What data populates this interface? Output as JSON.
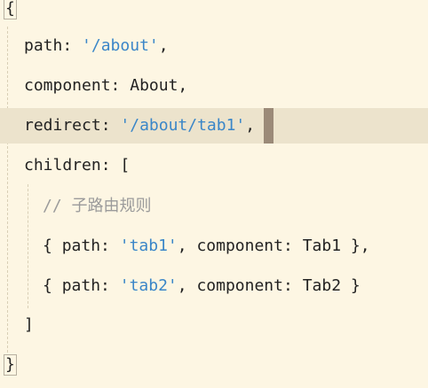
{
  "editor": {
    "lines": [
      {
        "text": "{"
      },
      {
        "key": "path",
        "sep": ": ",
        "str": "'/about'",
        "tail": ","
      },
      {
        "key": "component",
        "sep": ": ",
        "value": "About",
        "tail": ","
      },
      {
        "key": "redirect",
        "sep": ": ",
        "str": "'/about/tab1'",
        "tail": ","
      },
      {
        "key": "children",
        "sep": ": ",
        "tail": "["
      },
      {
        "comment": "// 子路由规则"
      },
      {
        "open": "{ ",
        "key1": "path",
        "sep1": ": ",
        "str": "'tab1'",
        "mid": ", ",
        "key2": "component",
        "sep2": ": ",
        "value": "Tab1",
        "close": " },"
      },
      {
        "open": "{ ",
        "key1": "path",
        "sep1": ": ",
        "str": "'tab2'",
        "mid": ", ",
        "key2": "component",
        "sep2": ": ",
        "value": "Tab2",
        "close": " }"
      },
      {
        "text": "]"
      },
      {
        "text": "}"
      }
    ]
  },
  "colors": {
    "background": "#fdf6e3",
    "highlight": "#ece3cc",
    "string": "#3a86c8",
    "comment": "#9b9b9b",
    "cursor": "#9b8a78"
  }
}
